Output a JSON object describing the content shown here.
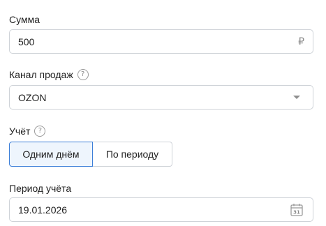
{
  "amount": {
    "label": "Сумма",
    "value": "500",
    "currency": "₽"
  },
  "sales_channel": {
    "label": "Канал продаж",
    "help": "?",
    "selected": "OZON"
  },
  "accounting": {
    "label": "Учёт",
    "help": "?",
    "options": [
      "Одним днём",
      "По периоду"
    ],
    "selected_index": 0
  },
  "period": {
    "label": "Период учёта",
    "value": "19.01.2026",
    "calendar_day": "31"
  },
  "colors": {
    "accent": "#3d7fd8",
    "active_bg": "#eef5fd",
    "border": "#cfd3d8"
  }
}
